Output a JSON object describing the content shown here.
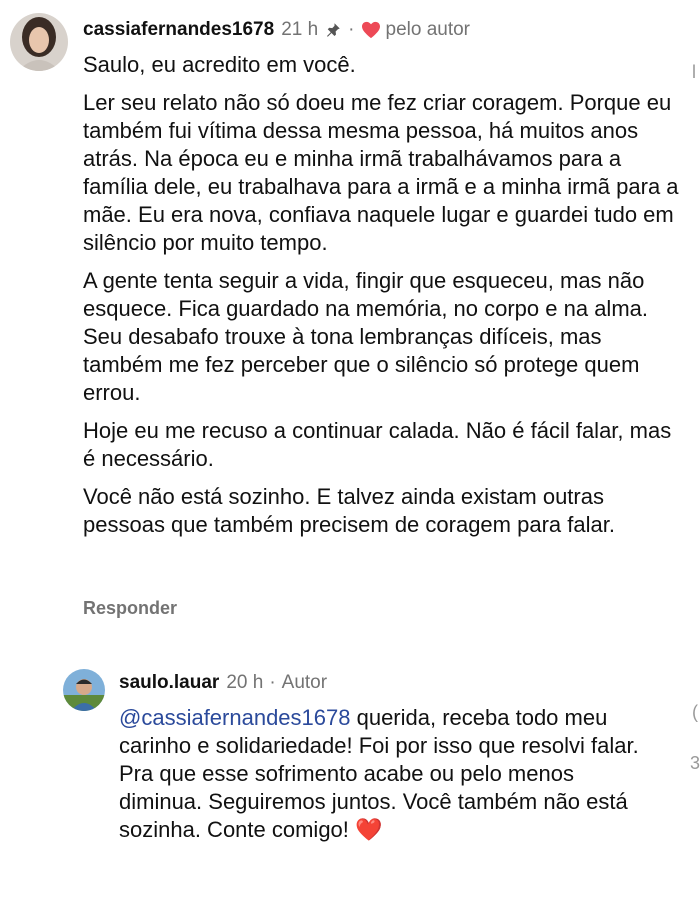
{
  "comment": {
    "username": "cassiafernandes1678",
    "time": "21 h",
    "separator": "·",
    "liked_by_author_label": "pelo autor",
    "paragraphs": [
      "Saulo, eu acredito em você.",
      "Ler seu relato não só doeu me fez criar coragem. Porque eu também fui vítima dessa mesma pessoa, há muitos anos atrás. Na época eu e minha irmã trabalhávamos para a família dele, eu trabalhava para a irmã e a minha irmã para a mãe. Eu era nova, confiava naquele lugar e guardei tudo em silêncio por muito tempo.",
      "A gente tenta seguir a vida, fingir que esqueceu, mas não esquece. Fica guardado na memória, no corpo e na alma. Seu desabafo trouxe à tona lembranças difíceis, mas também me fez perceber que o silêncio só protege quem errou.",
      "Hoje eu me recuso a continuar calada. Não é fácil falar, mas é necessário.",
      "Você não está sozinho. E talvez ainda existam outras pessoas que também precisem de coragem para falar."
    ],
    "reply_label": "Responder"
  },
  "reply": {
    "username": "saulo.lauar",
    "time": "20 h",
    "separator": "·",
    "author_label": "Autor",
    "mention": "@cassiafernandes1678",
    "text": " querida, receba todo meu carinho e solidariedade! Foi por isso que resolvi falar. Pra que esse sofrimento acabe ou pelo menos diminua. Seguiremos juntos. Você também não está sozinha. Conte comigo! ❤️"
  },
  "edge_fragments": {
    "top_right": "l",
    "mid_right": "(",
    "count_right": "3"
  },
  "colors": {
    "heart": "#ed4956",
    "mention": "#2b4a9b",
    "muted": "#737373"
  },
  "icons": [
    "pin-icon",
    "heart-icon"
  ]
}
